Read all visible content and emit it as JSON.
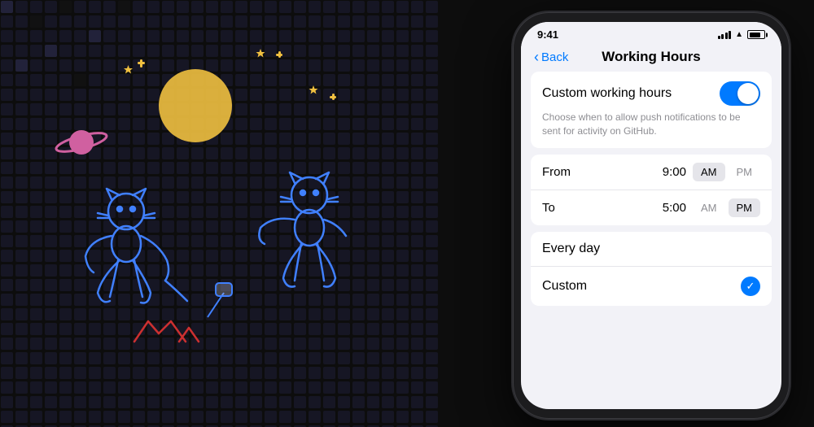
{
  "background": {
    "color": "#0d0d0d"
  },
  "statusBar": {
    "time": "9:41",
    "batteryFill": "80%"
  },
  "navigation": {
    "backLabel": "Back",
    "title": "Working Hours"
  },
  "toggleSection": {
    "label": "Custom working hours",
    "description": "Choose when to allow push notifications to be sent for activity on GitHub.",
    "enabled": true
  },
  "timeSection": {
    "fromLabel": "From",
    "fromValue": "9:00",
    "fromAm": "AM",
    "fromPm": "PM",
    "toLabel": "To",
    "toValue": "5:00",
    "toAm": "AM",
    "toPm": "PM"
  },
  "scheduleSection": {
    "everyDayLabel": "Every day",
    "customLabel": "Custom",
    "customSelected": true
  },
  "icons": {
    "backChevron": "‹",
    "checkmark": "✓"
  }
}
